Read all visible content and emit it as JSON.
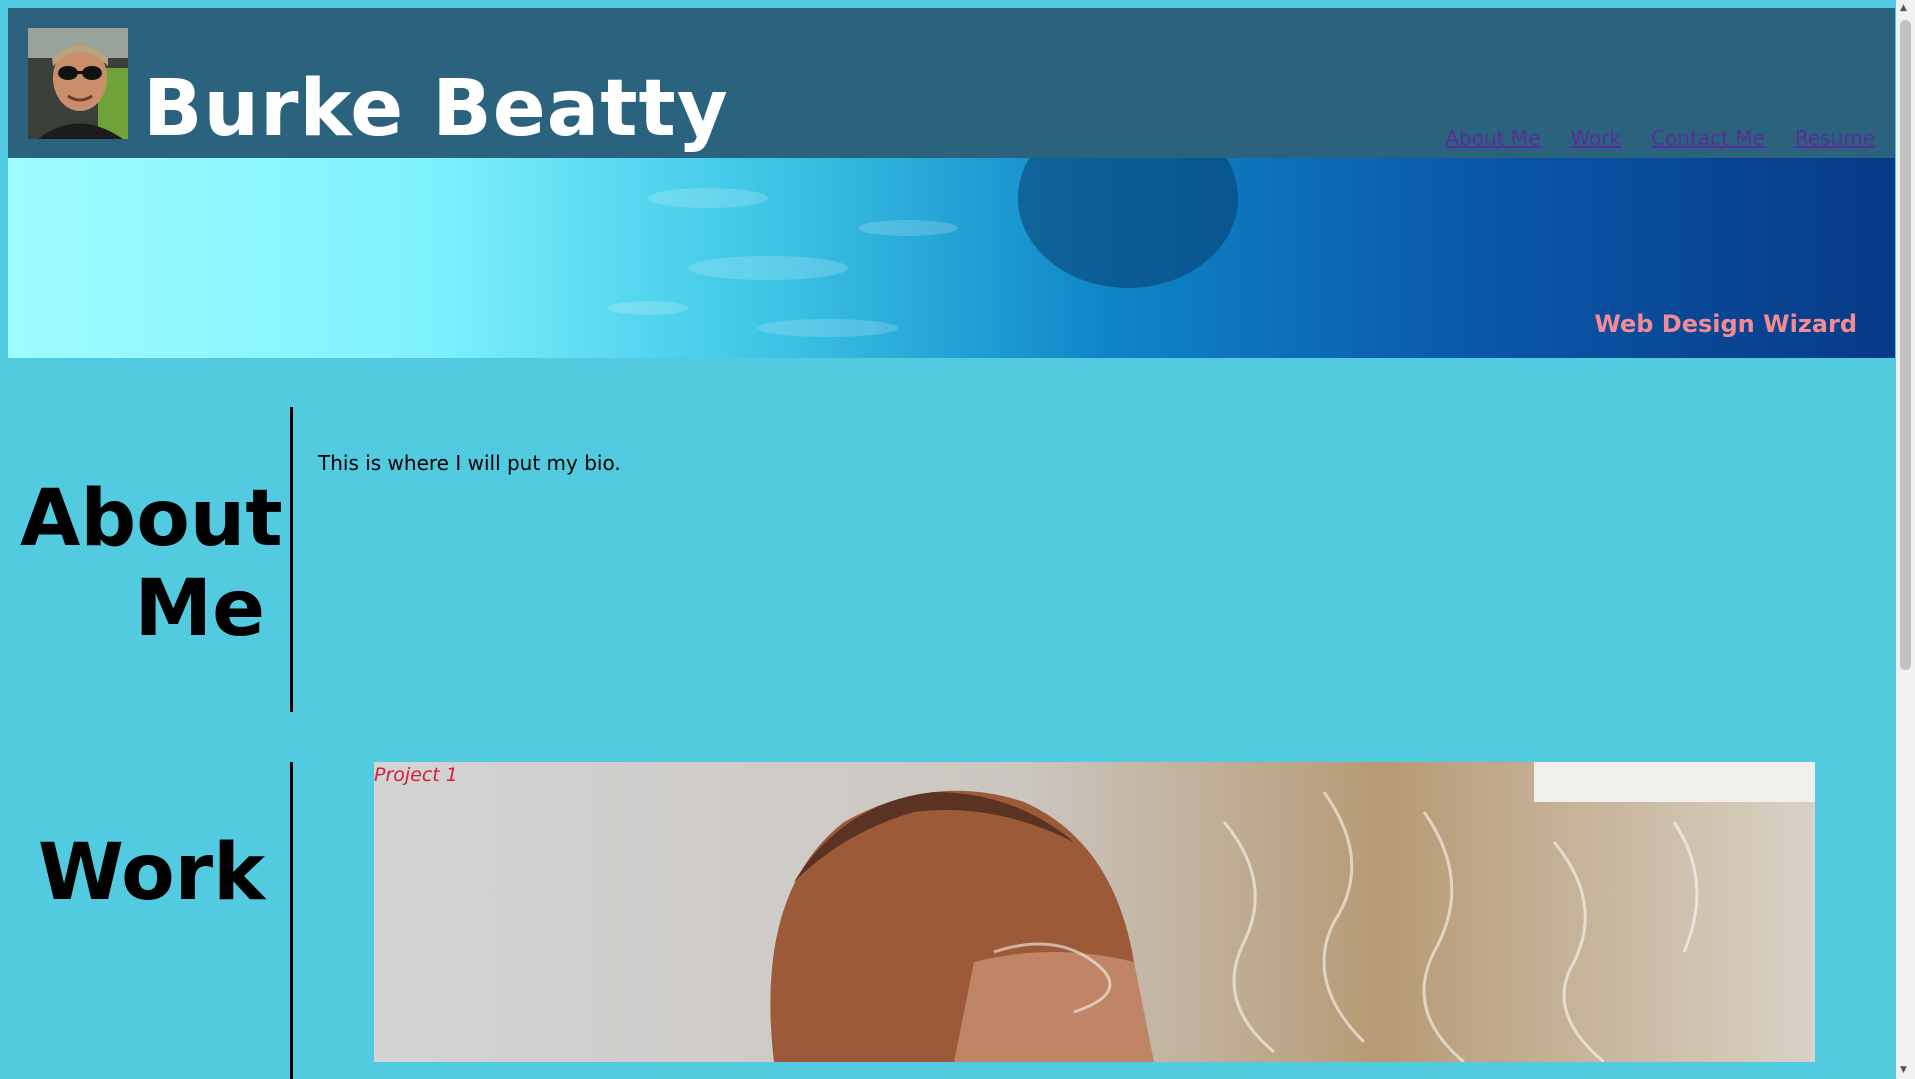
{
  "header": {
    "name": "Burke Beatty",
    "nav": [
      "About Me",
      "Work",
      "Contact Me",
      "Resume"
    ]
  },
  "hero": {
    "tagline": "Web Design Wizard"
  },
  "about": {
    "title_line1": "About",
    "title_line2": "Me",
    "bio": "This is where I will put my bio."
  },
  "work": {
    "title": "Work",
    "project_label": "Project 1"
  },
  "colors": {
    "page_bg": "#52cbe1",
    "header_bg": "#2b627e",
    "tagline": "#f28b93",
    "nav_link": "#5b2d9b",
    "project_label": "#d21f3c"
  }
}
